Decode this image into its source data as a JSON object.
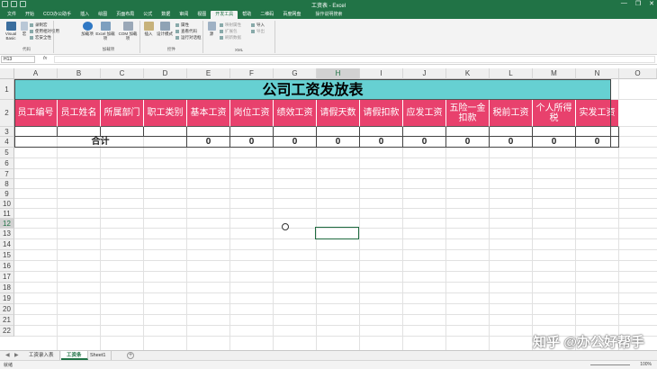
{
  "window": {
    "title": "工资表 - Excel",
    "controls": [
      "—",
      "❐",
      "✕"
    ]
  },
  "tabs": [
    {
      "label": "文件"
    },
    {
      "label": "开始"
    },
    {
      "label": "CCO办公助手"
    },
    {
      "label": "插入"
    },
    {
      "label": "绘图"
    },
    {
      "label": "页面布局"
    },
    {
      "label": "公式"
    },
    {
      "label": "数据"
    },
    {
      "label": "审阅"
    },
    {
      "label": "视图"
    },
    {
      "label": "开发工具",
      "active": true
    },
    {
      "label": "帮助"
    },
    {
      "label": "二维码"
    },
    {
      "label": "百度网盘"
    }
  ],
  "search_label": "操作说明搜索",
  "ribbon": {
    "groups": [
      {
        "label": "代码"
      },
      {
        "label": "加载项"
      },
      {
        "label": "控件"
      },
      {
        "label": "XML"
      }
    ],
    "code": {
      "visual_basic": "Visual Basic",
      "macro": "宏",
      "record_macro": "录制宏",
      "relative_ref": "使用相对引用",
      "macro_security": "宏安全性"
    },
    "addins": {
      "addins": "加载项",
      "excel_addins": "Excel 加载项",
      "com_addins": "COM 加载项"
    },
    "controls": {
      "insert": "插入",
      "design_mode": "设计模式",
      "properties": "属性",
      "view_code": "查看代码",
      "run_dialog": "运行对话框"
    },
    "xml": {
      "source": "源",
      "map_props": "映射属性",
      "expansion": "扩展包",
      "refresh": "刷新数据",
      "import": "导入",
      "export": "导出"
    }
  },
  "formula_bar": {
    "name_box": "H13",
    "fx": "fx",
    "value": ""
  },
  "columns": [
    "A",
    "B",
    "C",
    "D",
    "E",
    "F",
    "G",
    "H",
    "I",
    "J",
    "K",
    "L",
    "M",
    "N",
    "O"
  ],
  "selected_column": "H",
  "rows": [
    "1",
    "2",
    "3",
    "4",
    "5",
    "6",
    "7",
    "8",
    "9",
    "10",
    "11",
    "12",
    "13",
    "14",
    "15",
    "16",
    "17",
    "18",
    "19",
    "20",
    "21",
    "22"
  ],
  "selected_row": "12",
  "sheet": {
    "title": "公司工资发放表",
    "headers": [
      "员工编号",
      "员工姓名",
      "所属部门",
      "职工类别",
      "基本工资",
      "岗位工资",
      "绩效工资",
      "请假天数",
      "请假扣款",
      "应发工资",
      "五险一金扣款",
      "税前工资",
      "个人所得税",
      "实发工资"
    ],
    "total_label": "合计",
    "totals": [
      "0",
      "0",
      "0",
      "0",
      "0",
      "0",
      "0",
      "0",
      "0",
      "0"
    ]
  },
  "sheet_tabs": [
    {
      "label": "工资录入表"
    },
    {
      "label": "工资条",
      "active": true
    },
    {
      "label": "Sheet1"
    }
  ],
  "status": {
    "text": "就绪",
    "zoom": "100%"
  },
  "watermark": "知乎 @办公好帮手"
}
